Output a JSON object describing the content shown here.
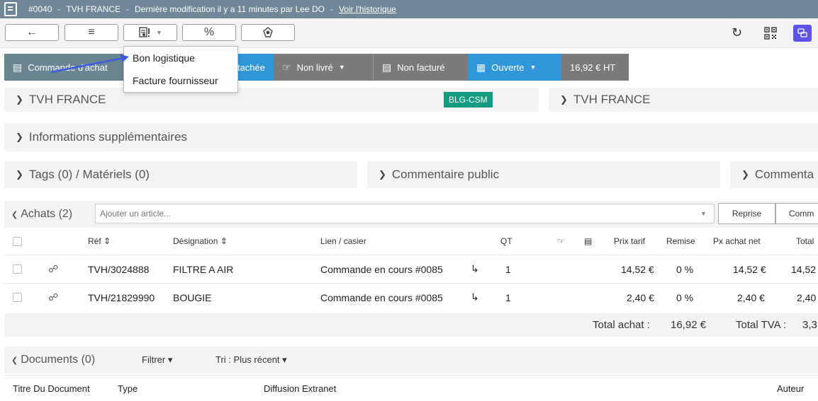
{
  "titlebar": {
    "number": "#0040",
    "supplier": "TVH FRANCE",
    "modified": "Dernière modification il y a 11 minutes par Lee DO",
    "history_link": "Voir l'historique",
    "separator": "-"
  },
  "toolbar": {
    "back_icon": "arrow-left-icon",
    "list_icon": "list-icon",
    "print_icon": "print-config-icon",
    "percent_label": "%",
    "stamp_icon": "stamp-icon",
    "refresh_icon": "refresh-icon",
    "qr_icon": "qr-code-icon",
    "chat_icon": "chat-icon"
  },
  "dropdown": {
    "items": [
      "Bon logistique",
      "Facture fournisseur"
    ]
  },
  "status": {
    "type_label": "Commande d'achat",
    "attached_label": "Attachée",
    "delivery_label": "Non livré",
    "invoice_label": "Non facturé",
    "state_label": "Ouverte",
    "amount_label": "16,92 € HT",
    "colors": {
      "type": "#6a8592",
      "attached": "#2f97d9",
      "delivery": "#7a7a7a",
      "invoice": "#7a7a7a",
      "state": "#2f97d9",
      "amount": "#7a7a7a"
    }
  },
  "panels": {
    "left_supplier": "TVH FRANCE",
    "badge": "BLG-CSM",
    "right_supplier": "TVH FRANCE",
    "extra_info": "Informations supplémentaires",
    "tags": "Tags (0) / Matériels (0)",
    "public_comment": "Commentaire public",
    "private_comment": "Commenta"
  },
  "achats": {
    "title": "Achats (2)",
    "input_placeholder": "Ajouter un article...",
    "reprise_label": "Reprise",
    "comm_label": "Comm",
    "columns": {
      "ref": "Réf ⇕",
      "designation": "Désignation ⇕",
      "lien": "Lien / casier",
      "qt": "QT",
      "prix_tarif": "Prix tarif",
      "remise": "Remise",
      "px_achat": "Px achat net",
      "total": "Total"
    },
    "rows": [
      {
        "ref": "TVH/3024888",
        "designation": "FILTRE A AIR",
        "lien": "Commande en cours #0085",
        "qt": "1",
        "prix": "14,52 €",
        "remise": "0 %",
        "px": "14,52 €",
        "total": "14,52"
      },
      {
        "ref": "TVH/21829990",
        "designation": "BOUGIE",
        "lien": "Commande en cours #0085",
        "qt": "1",
        "prix": "2,40 €",
        "remise": "0 %",
        "px": "2,40 €",
        "total": "2,40"
      }
    ],
    "totals": {
      "achat_label": "Total achat :",
      "achat_value": "16,92 €",
      "tva_label": "Total TVA :",
      "tva_value": "3,3"
    }
  },
  "documents": {
    "title": "Documents (0)",
    "filter_label": "Filtrer ▾",
    "sort_label": "Tri : Plus récent ▾",
    "col_title": "Titre Du Document",
    "col_type": "Type",
    "col_diffusion": "Diffusion Extranet",
    "col_author": "Auteur"
  }
}
